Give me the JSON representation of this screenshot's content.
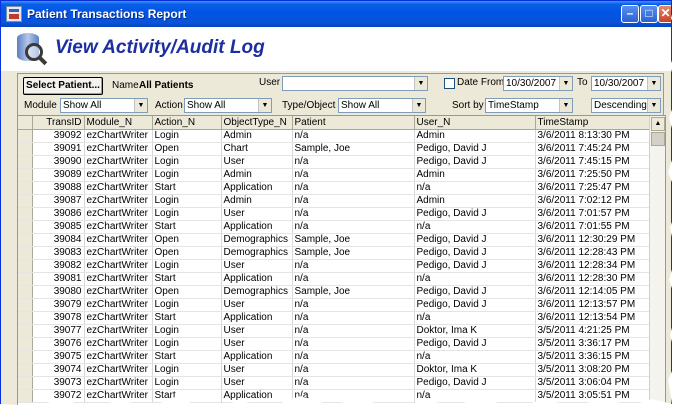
{
  "window": {
    "title": "Patient Transactions Report",
    "controls": {
      "minimize": "–",
      "maximize": "□",
      "close": "✕"
    }
  },
  "header": {
    "title": "View Activity/Audit Log",
    "logo_icon": "database-search-icon"
  },
  "filters": {
    "select_patient_label": "Select Patient...",
    "name_label": "Name",
    "name_value": "All Patients",
    "user_label": "User",
    "user_value": "",
    "date_from_label": "Date From",
    "date_from_checked": false,
    "date_from_value": "10/30/2007",
    "to_label": "To",
    "date_to_value": "10/30/2007",
    "module_label": "Module",
    "module_value": "Show All",
    "action_label": "Action",
    "action_value": "Show All",
    "type_label": "Type/Object",
    "type_value": "Show All",
    "sort_label": "Sort by",
    "sort_value": "TimeStamp",
    "order_value": "Descending"
  },
  "table": {
    "columns": [
      "TransID",
      "Module_N",
      "Action_N",
      "ObjectType_N",
      "Patient",
      "User_N",
      "TimeStamp"
    ],
    "rows": [
      [
        "39092",
        "ezChartWriter",
        "Login",
        "Admin",
        "n/a",
        "Admin",
        "3/6/2011 8:13:30 PM"
      ],
      [
        "39091",
        "ezChartWriter",
        "Open",
        "Chart",
        "Sample, Joe",
        "Pedigo, David J",
        "3/6/2011 7:45:24 PM"
      ],
      [
        "39090",
        "ezChartWriter",
        "Login",
        "User",
        "n/a",
        "Pedigo, David J",
        "3/6/2011 7:45:15 PM"
      ],
      [
        "39089",
        "ezChartWriter",
        "Login",
        "Admin",
        "n/a",
        "Admin",
        "3/6/2011 7:25:50 PM"
      ],
      [
        "39088",
        "ezChartWriter",
        "Start",
        "Application",
        "n/a",
        "n/a",
        "3/6/2011 7:25:47 PM"
      ],
      [
        "39087",
        "ezChartWriter",
        "Login",
        "Admin",
        "n/a",
        "Admin",
        "3/6/2011 7:02:12 PM"
      ],
      [
        "39086",
        "ezChartWriter",
        "Login",
        "User",
        "n/a",
        "Pedigo, David J",
        "3/6/2011 7:01:57 PM"
      ],
      [
        "39085",
        "ezChartWriter",
        "Start",
        "Application",
        "n/a",
        "n/a",
        "3/6/2011 7:01:55 PM"
      ],
      [
        "39084",
        "ezChartWriter",
        "Open",
        "Demographics",
        "Sample, Joe",
        "Pedigo, David J",
        "3/6/2011 12:30:29 PM"
      ],
      [
        "39083",
        "ezChartWriter",
        "Open",
        "Demographics",
        "Sample, Joe",
        "Pedigo, David J",
        "3/6/2011 12:28:43 PM"
      ],
      [
        "39082",
        "ezChartWriter",
        "Login",
        "User",
        "n/a",
        "Pedigo, David J",
        "3/6/2011 12:28:34 PM"
      ],
      [
        "39081",
        "ezChartWriter",
        "Start",
        "Application",
        "n/a",
        "n/a",
        "3/6/2011 12:28:30 PM"
      ],
      [
        "39080",
        "ezChartWriter",
        "Open",
        "Demographics",
        "Sample, Joe",
        "Pedigo, David J",
        "3/6/2011 12:14:05 PM"
      ],
      [
        "39079",
        "ezChartWriter",
        "Login",
        "User",
        "n/a",
        "Pedigo, David J",
        "3/6/2011 12:13:57 PM"
      ],
      [
        "39078",
        "ezChartWriter",
        "Start",
        "Application",
        "n/a",
        "n/a",
        "3/6/2011 12:13:54 PM"
      ],
      [
        "39077",
        "ezChartWriter",
        "Login",
        "User",
        "n/a",
        "Doktor, Ima K",
        "3/5/2011 4:21:25 PM"
      ],
      [
        "39076",
        "ezChartWriter",
        "Login",
        "User",
        "n/a",
        "Pedigo, David J",
        "3/5/2011 3:36:17 PM"
      ],
      [
        "39075",
        "ezChartWriter",
        "Start",
        "Application",
        "n/a",
        "n/a",
        "3/5/2011 3:36:15 PM"
      ],
      [
        "39074",
        "ezChartWriter",
        "Login",
        "User",
        "n/a",
        "Doktor, Ima K",
        "3/5/2011 3:08:20 PM"
      ],
      [
        "39073",
        "ezChartWriter",
        "Login",
        "User",
        "n/a",
        "Pedigo, David J",
        "3/5/2011 3:06:04 PM"
      ],
      [
        "39072",
        "ezChartWriter",
        "Start",
        "Application",
        "n/a",
        "n/a",
        "3/5/2011 3:05:51 PM"
      ]
    ]
  },
  "colors": {
    "title_bar": "#0054e3",
    "heading": "#1c2ea0",
    "chrome": "#ece9d8"
  }
}
